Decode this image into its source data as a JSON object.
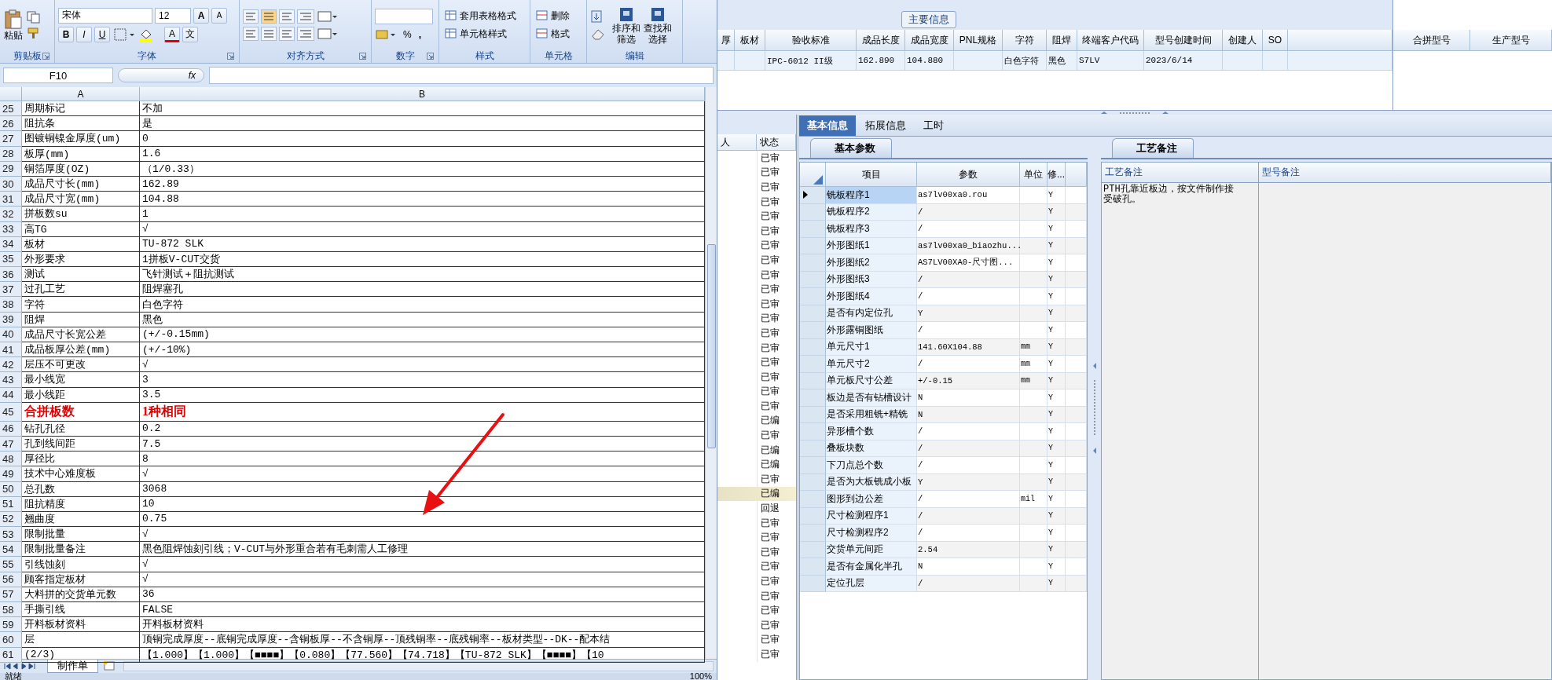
{
  "excel": {
    "ribbon": [
      {
        "kind": "clipboard",
        "label": "剪贴板",
        "launcher": true,
        "paste": "粘贴"
      },
      {
        "kind": "font",
        "label": "字体",
        "launcher": true,
        "font_name": "宋体",
        "font_size": "12",
        "grow": "A",
        "shrink": "A",
        "bold": "B",
        "italic": "I",
        "underline": "U",
        "font_color": "A",
        "phonetic": "文"
      },
      {
        "kind": "alignment",
        "label": "对齐方式",
        "launcher": true
      },
      {
        "kind": "number",
        "label": "数字",
        "launcher": true,
        "percent": "%",
        "comma": ","
      },
      {
        "kind": "styles",
        "label": "样式",
        "launcher": false,
        "items": [
          "套用表格格式",
          "单元格样式"
        ]
      },
      {
        "kind": "cells",
        "label": "单元格",
        "launcher": false,
        "items": [
          "删除",
          "格式"
        ]
      },
      {
        "kind": "editing",
        "label": "编辑",
        "launcher": false,
        "buttons": [
          [
            "排序和",
            "筛选"
          ],
          [
            "查找和",
            "选择"
          ]
        ]
      }
    ],
    "name_box": "F10",
    "fx": "fx",
    "columns": [
      "A",
      "B"
    ],
    "rows": [
      {
        "num": "25",
        "a": "周期标记",
        "b": "不加",
        "highlighted": false
      },
      {
        "num": "26",
        "a": "阻抗条",
        "b": "是",
        "highlighted": false
      },
      {
        "num": "27",
        "a": "图镀铜镍金厚度(um)",
        "b": "0",
        "highlighted": false
      },
      {
        "num": "28",
        "a": "板厚(mm)",
        "b": "1.6",
        "highlighted": false
      },
      {
        "num": "29",
        "a": "铜箔厚度(OZ)",
        "b": "（1/0.33）",
        "highlighted": false
      },
      {
        "num": "30",
        "a": "成品尺寸长(mm)",
        "b": "162.89",
        "highlighted": false
      },
      {
        "num": "31",
        "a": "成品尺寸宽(mm)",
        "b": "104.88",
        "highlighted": false
      },
      {
        "num": "32",
        "a": "拼板数su",
        "b": "1",
        "highlighted": false
      },
      {
        "num": "33",
        "a": "高TG",
        "b": "√",
        "highlighted": false
      },
      {
        "num": "34",
        "a": "板材",
        "b": "TU-872 SLK",
        "highlighted": false
      },
      {
        "num": "35",
        "a": "外形要求",
        "b": "1拼板V-CUT交货",
        "highlighted": false
      },
      {
        "num": "36",
        "a": "测试",
        "b": "飞针测试＋阻抗测试",
        "highlighted": false
      },
      {
        "num": "37",
        "a": "过孔工艺",
        "b": "阻焊塞孔",
        "highlighted": false
      },
      {
        "num": "38",
        "a": "字符",
        "b": "白色字符",
        "highlighted": false
      },
      {
        "num": "39",
        "a": "阻焊",
        "b": "黑色",
        "highlighted": false
      },
      {
        "num": "40",
        "a": "成品尺寸长宽公差",
        "b": "(+/-0.15mm)",
        "highlighted": false
      },
      {
        "num": "41",
        "a": "成品板厚公差(mm)",
        "b": "(+/-10%)",
        "highlighted": false
      },
      {
        "num": "42",
        "a": "层压不可更改",
        "b": "√",
        "highlighted": false
      },
      {
        "num": "43",
        "a": "最小线宽",
        "b": "3",
        "highlighted": false
      },
      {
        "num": "44",
        "a": "最小线距",
        "b": "3.5",
        "highlighted": false
      },
      {
        "num": "45",
        "a": "合拼板数",
        "b": "1种相同",
        "highlighted": true
      },
      {
        "num": "46",
        "a": "钻孔孔径",
        "b": "0.2",
        "highlighted": false
      },
      {
        "num": "47",
        "a": "孔到线间距",
        "b": "7.5",
        "highlighted": false
      },
      {
        "num": "48",
        "a": "厚径比",
        "b": "8",
        "highlighted": false
      },
      {
        "num": "49",
        "a": "技术中心难度板",
        "b": "√",
        "highlighted": false
      },
      {
        "num": "50",
        "a": "总孔数",
        "b": "3068",
        "highlighted": false
      },
      {
        "num": "51",
        "a": "阻抗精度",
        "b": "10",
        "highlighted": false
      },
      {
        "num": "52",
        "a": "翘曲度",
        "b": "0.75",
        "highlighted": false
      },
      {
        "num": "53",
        "a": "限制批量",
        "b": "√",
        "highlighted": false
      },
      {
        "num": "54",
        "a": "限制批量备注",
        "b": "黑色阻焊蚀刻引线；V-CUT与外形重合若有毛刺需人工修理",
        "highlighted": false
      },
      {
        "num": "55",
        "a": "引线蚀刻",
        "b": "√",
        "highlighted": false
      },
      {
        "num": "56",
        "a": "顾客指定板材",
        "b": "√",
        "highlighted": false
      },
      {
        "num": "57",
        "a": "大料拼的交货单元数",
        "b": "36",
        "highlighted": false
      },
      {
        "num": "58",
        "a": "手撕引线",
        "b": "FALSE",
        "highlighted": false
      },
      {
        "num": "59",
        "a": "开料板材资料",
        "b": "开料板材资料",
        "highlighted": false
      },
      {
        "num": "60",
        "a": "层",
        "b": "顶铜完成厚度--底铜完成厚度--含铜板厚--不含铜厚--顶残铜率--底残铜率--板材类型--DK--配本结",
        "highlighted": false
      },
      {
        "num": "61",
        "a": "(2/3)",
        "b": "【1.000】【1.000】【■■■■】【0.080】【77.560】【74.718】【TU-872 SLK】【■■■■】【10",
        "highlighted": false
      }
    ],
    "sheet_tabs": [
      {
        "label": "制作单",
        "selected": true
      }
    ],
    "status": "就绪",
    "zoom": "100%"
  },
  "app": {
    "main_info": {
      "title": "主要信息",
      "columns": [
        "厚",
        "板材",
        "验收标准",
        "成品长度",
        "成品宽度",
        "PNL规格",
        "字符",
        "阻焊",
        "终端客户代码",
        "型号创建时间",
        "创建人",
        "SO"
      ],
      "rows": [
        [
          "",
          "",
          "IPC-6012 II级",
          "162.890",
          "104.880",
          "",
          "白色字符",
          "黑色",
          "S7LV",
          "2023/6/14",
          "",
          ""
        ]
      ],
      "side_columns": [
        "合拼型号",
        "生产型号"
      ]
    },
    "list": {
      "columns": [
        "人",
        "状态"
      ],
      "rows": [
        {
          "status": "已审",
          "selected": false
        },
        {
          "status": "已审",
          "selected": false
        },
        {
          "status": "已审",
          "selected": false
        },
        {
          "status": "已审",
          "selected": false
        },
        {
          "status": "已审",
          "selected": false
        },
        {
          "status": "已审",
          "selected": false
        },
        {
          "status": "已审",
          "selected": false
        },
        {
          "status": "已审",
          "selected": false
        },
        {
          "status": "已审",
          "selected": false
        },
        {
          "status": "已审",
          "selected": false
        },
        {
          "status": "已审",
          "selected": false
        },
        {
          "status": "已审",
          "selected": false
        },
        {
          "status": "已审",
          "selected": false
        },
        {
          "status": "已审",
          "selected": false
        },
        {
          "status": "已审",
          "selected": false
        },
        {
          "status": "已审",
          "selected": false
        },
        {
          "status": "已审",
          "selected": false
        },
        {
          "status": "已审",
          "selected": false
        },
        {
          "status": "已编",
          "selected": false
        },
        {
          "status": "已审",
          "selected": false
        },
        {
          "status": "已编",
          "selected": false
        },
        {
          "status": "已编",
          "selected": false
        },
        {
          "status": "已审",
          "selected": false
        },
        {
          "status": "已编",
          "selected": true
        },
        {
          "status": "回退",
          "selected": false
        },
        {
          "status": "已审",
          "selected": false
        },
        {
          "status": "已审",
          "selected": false
        },
        {
          "status": "已审",
          "selected": false
        },
        {
          "status": "已审",
          "selected": false
        },
        {
          "status": "已审",
          "selected": false
        },
        {
          "status": "已审",
          "selected": false
        },
        {
          "status": "已审",
          "selected": false
        },
        {
          "status": "已审",
          "selected": false
        },
        {
          "status": "已审",
          "selected": false
        },
        {
          "status": "已审",
          "selected": false
        }
      ]
    },
    "tabs": [
      {
        "label": "基本信息",
        "selected": true
      },
      {
        "label": "拓展信息",
        "selected": false
      },
      {
        "label": "工时",
        "selected": false
      }
    ],
    "params": {
      "tab": "基本参数",
      "columns": [
        "项目",
        "参数",
        "单位",
        "修..."
      ],
      "rows": [
        {
          "item": "铣板程序1",
          "value": "as7lv00xa0.rou",
          "unit": "",
          "mod": "Y",
          "selected": true
        },
        {
          "item": "铣板程序2",
          "value": "/",
          "unit": "",
          "mod": "Y",
          "selected": false
        },
        {
          "item": "铣板程序3",
          "value": "/",
          "unit": "",
          "mod": "Y",
          "selected": false
        },
        {
          "item": "外形图纸1",
          "value": "as7lv00xa0_biaozhu...",
          "unit": "",
          "mod": "Y",
          "selected": false
        },
        {
          "item": "外形图纸2",
          "value": "AS7LV00XA0-尺寸图...",
          "unit": "",
          "mod": "Y",
          "selected": false
        },
        {
          "item": "外形图纸3",
          "value": "/",
          "unit": "",
          "mod": "Y",
          "selected": false
        },
        {
          "item": "外形图纸4",
          "value": "/",
          "unit": "",
          "mod": "Y",
          "selected": false
        },
        {
          "item": "是否有内定位孔",
          "value": "Y",
          "unit": "",
          "mod": "Y",
          "selected": false
        },
        {
          "item": "外形露铜图纸",
          "value": "/",
          "unit": "",
          "mod": "Y",
          "selected": false
        },
        {
          "item": "单元尺寸1",
          "value": "141.60X104.88",
          "unit": "mm",
          "mod": "Y",
          "selected": false
        },
        {
          "item": "单元尺寸2",
          "value": "/",
          "unit": "mm",
          "mod": "Y",
          "selected": false
        },
        {
          "item": "单元板尺寸公差",
          "value": "+/-0.15",
          "unit": "mm",
          "mod": "Y",
          "selected": false
        },
        {
          "item": "板边是否有钻槽设计",
          "value": "N",
          "unit": "",
          "mod": "Y",
          "selected": false
        },
        {
          "item": "是否采用粗铣+精铣",
          "value": "N",
          "unit": "",
          "mod": "Y",
          "selected": false
        },
        {
          "item": "异形槽个数",
          "value": "/",
          "unit": "",
          "mod": "Y",
          "selected": false
        },
        {
          "item": "叠板块数",
          "value": "/",
          "unit": "",
          "mod": "Y",
          "selected": false
        },
        {
          "item": "下刀点总个数",
          "value": "/",
          "unit": "",
          "mod": "Y",
          "selected": false
        },
        {
          "item": "是否为大板铣成小板",
          "value": "Y",
          "unit": "",
          "mod": "Y",
          "selected": false
        },
        {
          "item": "图形到边公差",
          "value": "/",
          "unit": "mil",
          "mod": "Y",
          "selected": false
        },
        {
          "item": "尺寸检测程序1",
          "value": "/",
          "unit": "",
          "mod": "Y",
          "selected": false
        },
        {
          "item": "尺寸检测程序2",
          "value": "/",
          "unit": "",
          "mod": "Y",
          "selected": false
        },
        {
          "item": "交货单元间距",
          "value": "2.54",
          "unit": "",
          "mod": "Y",
          "selected": false
        },
        {
          "item": "是否有金属化半孔",
          "value": "N",
          "unit": "",
          "mod": "Y",
          "selected": false
        },
        {
          "item": "定位孔层",
          "value": "/",
          "unit": "",
          "mod": "Y",
          "selected": false
        }
      ]
    },
    "remarks": {
      "tab": "工艺备注",
      "columns": [
        "工艺备注",
        "型号备注"
      ],
      "process_note": "PTH孔靠近板边，按文件制作接受破孔。"
    }
  }
}
